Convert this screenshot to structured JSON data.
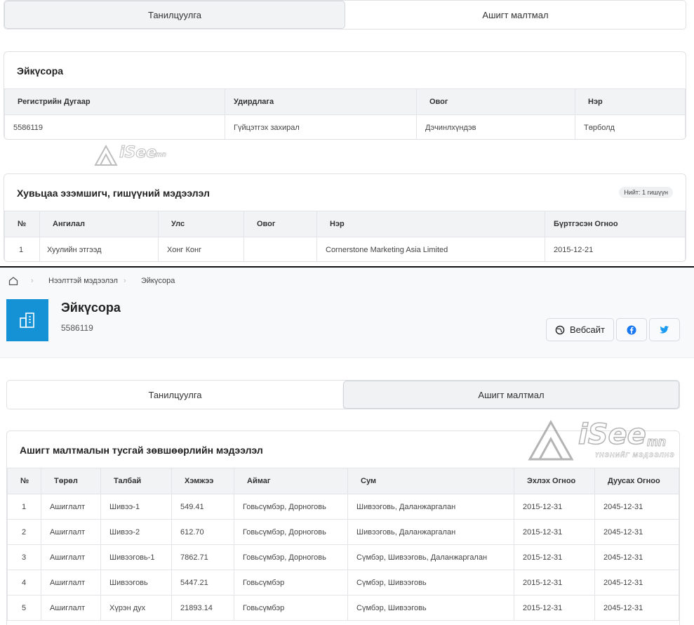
{
  "top_tabs": {
    "intro": "Танилцуулга",
    "minerals": "Ашигт малтмал"
  },
  "company_card": {
    "title": "Эйкүсора",
    "headers": [
      "Регистрийн Дугаар",
      "Удирдлага",
      "Овог",
      "Нэр"
    ],
    "row": [
      "5586119",
      "Гүйцэтгэх захирал",
      "Дэчинлхүндэв",
      "Төрболд"
    ]
  },
  "shareholders_card": {
    "title": "Хувьцаа эзэмшигч, гишүүний мэдээлэл",
    "count_badge": "Нийт: 1 гишүүн",
    "headers": [
      "№",
      "Ангилал",
      "Улс",
      "Овог",
      "Нэр",
      "Бүртгэсэн Огноо"
    ],
    "row": [
      "1",
      "Хуулийн этгээд",
      "Хонг Конг",
      "",
      "Cornerstone Marketing Asia Limited",
      "2015-12-21"
    ]
  },
  "watermark": {
    "brand": "iSee",
    "suffix": "mn",
    "tagline": "ҮНЭНИЙГ МЭДЭЭЛНЭ"
  },
  "breadcrumb": {
    "item1": "Нээлттэй мэдээлэл",
    "item2": "Эйкүсора"
  },
  "company_header": {
    "name": "Эйкүсора",
    "register_no": "5586119",
    "website_label": "Вебсайт",
    "facebook_color": "#1877f2",
    "twitter_color": "#1d9bf0",
    "logo_bg": "#1592d6"
  },
  "bottom_tabs": {
    "intro": "Танилцуулга",
    "minerals": "Ашигт малтмал"
  },
  "license_card": {
    "title": "Ашигт малтмалын тусгай зөвшөөрлийн мэдээлэл",
    "headers": [
      "№",
      "Төрөл",
      "Талбай",
      "Хэмжээ",
      "Аймаг",
      "Сум",
      "Эхлэх Огноо",
      "Дуусах Огноо"
    ],
    "rows": [
      [
        "1",
        "Ашиглалт",
        "Шивээ-1",
        "549.41",
        "Говьсүмбэр, Дорноговь",
        "Шивээговь, Даланжаргалан",
        "2015-12-31",
        "2045-12-31"
      ],
      [
        "2",
        "Ашиглалт",
        "Шивээ-2",
        "612.70",
        "Говьсүмбэр, Дорноговь",
        "Шивээговь, Даланжаргалан",
        "2015-12-31",
        "2045-12-31"
      ],
      [
        "3",
        "Ашиглалт",
        "Шивээговь-1",
        "7862.71",
        "Говьсүмбэр, Дорноговь",
        "Сүмбэр, Шивээговь, Даланжаргалан",
        "2015-12-31",
        "2045-12-31"
      ],
      [
        "4",
        "Ашиглалт",
        "Шивээговь",
        "5447.21",
        "Говьсүмбэр",
        "Сүмбэр, Шивээговь",
        "2015-12-31",
        "2045-12-31"
      ],
      [
        "5",
        "Ашиглалт",
        "Хүрэн дух",
        "21893.14",
        "Говьсүмбэр",
        "Сүмбэр, Шивээговь",
        "2015-12-31",
        "2045-12-31"
      ]
    ]
  }
}
